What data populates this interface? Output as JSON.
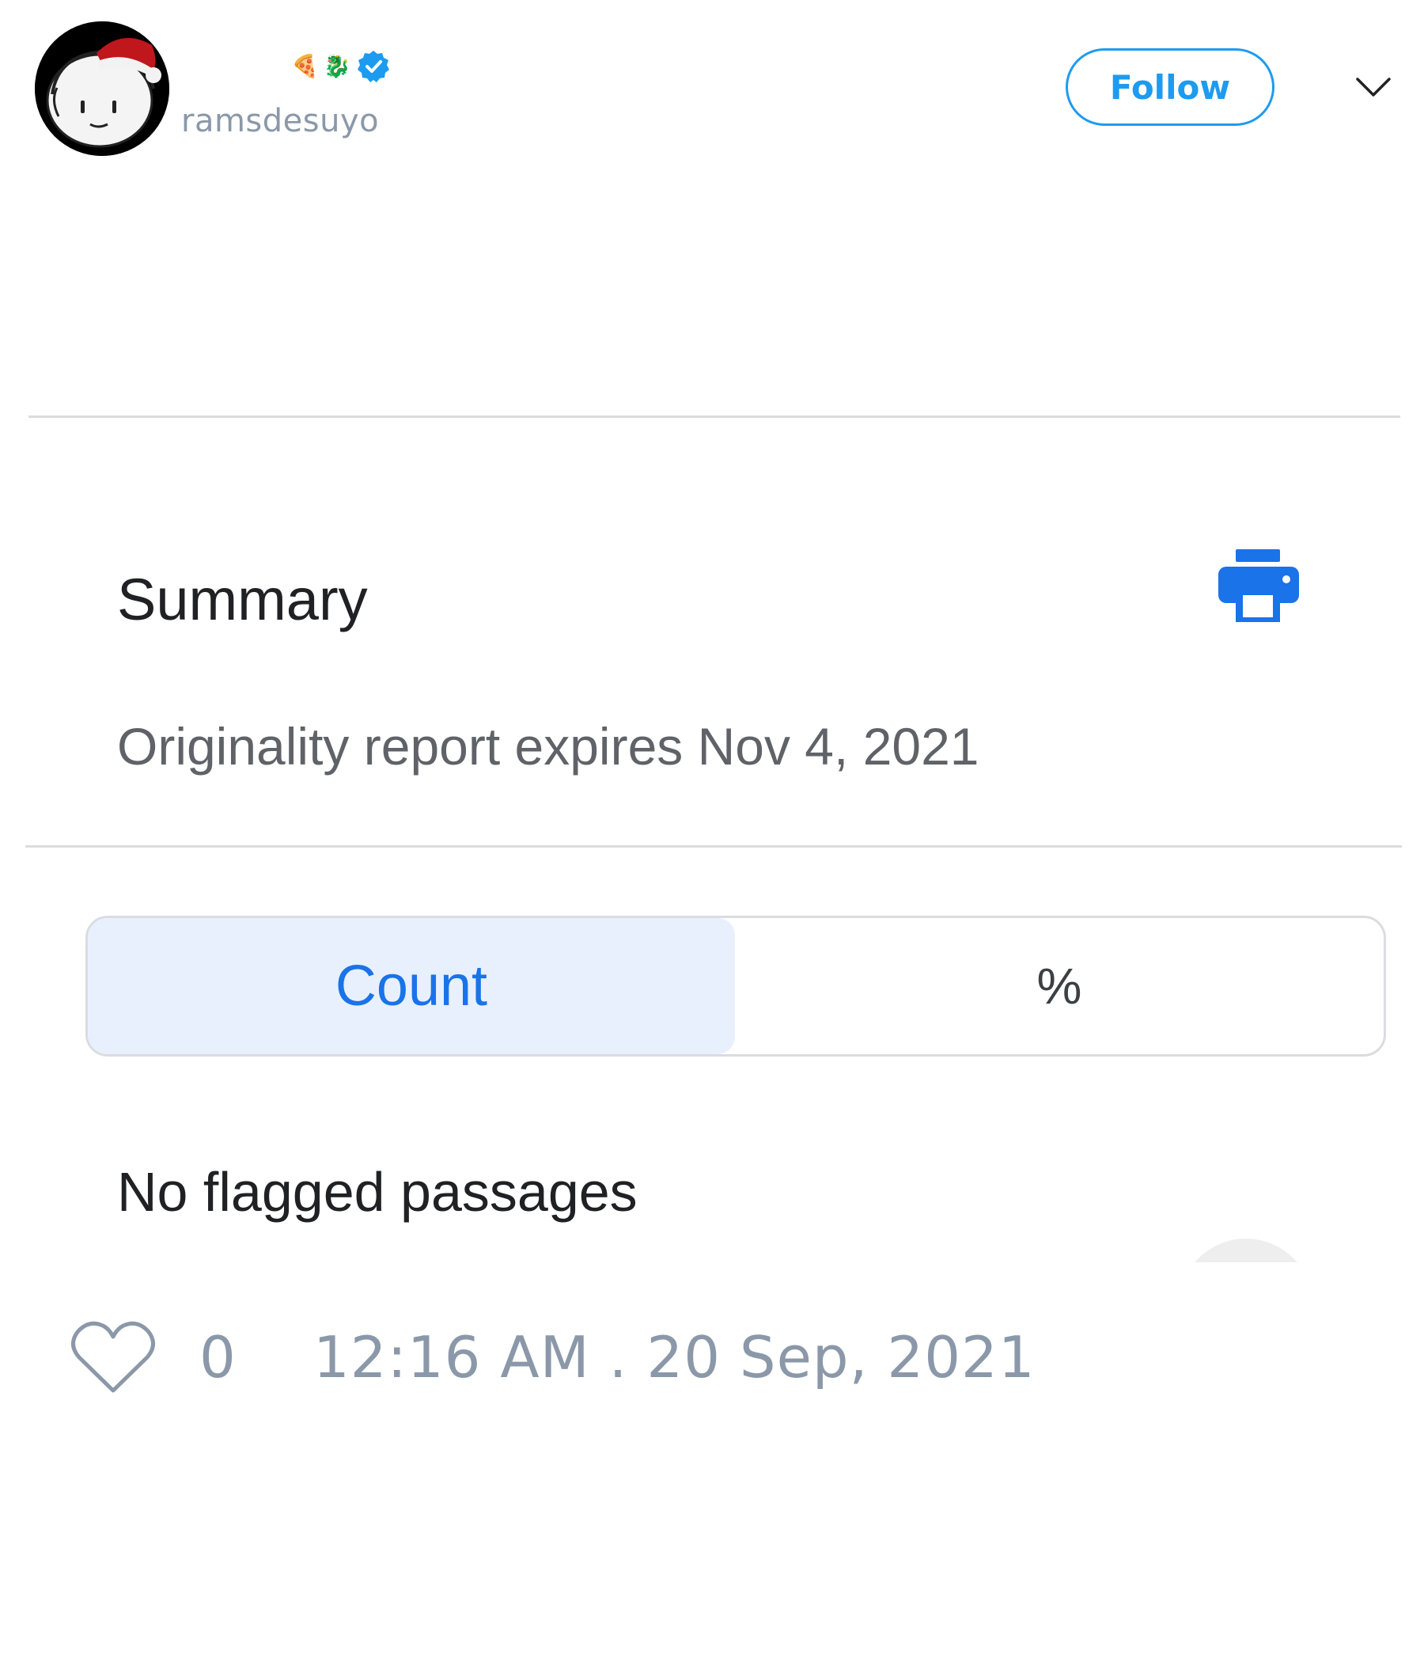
{
  "tweet": {
    "author": {
      "handle": "ramsdesuyo",
      "name_emojis": [
        "🍕",
        "🐉"
      ],
      "verified": true
    },
    "follow_label": "Follow",
    "like_count": "0",
    "timestamp": "12:16 AM . 20 Sep, 2021"
  },
  "embedded_screenshot": {
    "summary_title": "Summary",
    "expiry_text": "Originality report expires Nov 4, 2021",
    "toggle": {
      "options": [
        "Count",
        "%"
      ],
      "selected": "Count"
    },
    "result_text": "No flagged passages"
  },
  "colors": {
    "twitter_blue": "#1d9bf0",
    "muted_gray": "#8b98a9",
    "google_blue": "#1a73e8",
    "selected_tab_bg": "#e8f0fe"
  },
  "icons": {
    "avatar": "cartoon-avatar-with-santa-hat",
    "verified": "verified-badge-icon",
    "menu": "chevron-down-icon",
    "print": "print-icon",
    "like": "heart-icon"
  }
}
